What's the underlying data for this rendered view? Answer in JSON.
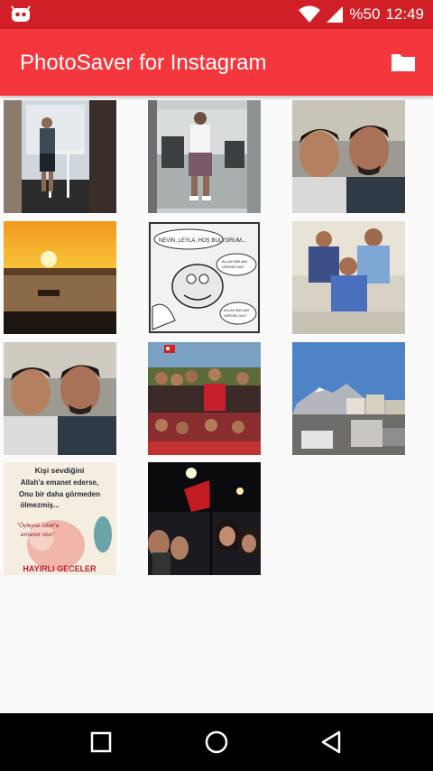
{
  "status": {
    "battery_text": "%50",
    "time": "12:49",
    "icons": [
      "cyanogen-icon",
      "wifi-icon",
      "signal-icon"
    ]
  },
  "app_bar": {
    "title": "PhotoSaver for Instagram",
    "action_icon": "folder-icon"
  },
  "thumbnails": [
    {
      "name": "photo-man-balcony"
    },
    {
      "name": "photo-gym-mirror-selfie"
    },
    {
      "name": "photo-two-men-selfie"
    },
    {
      "name": "photo-sunset-sea"
    },
    {
      "name": "photo-comic-strip",
      "texts": [
        "NEVİN, LEYLA, HOŞ BULYORUM...",
        "ALLAH BELANI VERSİN SAİT...",
        "ALLAH BELANI VERSİN GAIT..."
      ]
    },
    {
      "name": "photo-three-men-group"
    },
    {
      "name": "photo-two-men-selfie-2"
    },
    {
      "name": "photo-friends-collage"
    },
    {
      "name": "photo-mountain-street"
    },
    {
      "name": "photo-quote-card",
      "texts": [
        "Kişi sevdiğini",
        "Allah'a emanet ederse,",
        "Onu bir daha görmeden",
        "ölmezmiş...",
        "\"Öyleyse Allah'a",
        "emanet olun\"",
        "HAYIRLI GECELER"
      ]
    },
    {
      "name": "photo-night-collage"
    }
  ],
  "nav": {
    "icons": [
      "recents-icon",
      "home-icon",
      "back-icon"
    ]
  },
  "colors": {
    "status_bar": "#d01f26",
    "app_bar": "#f4373d",
    "background": "#fafafa",
    "nav_bar": "#000000"
  }
}
